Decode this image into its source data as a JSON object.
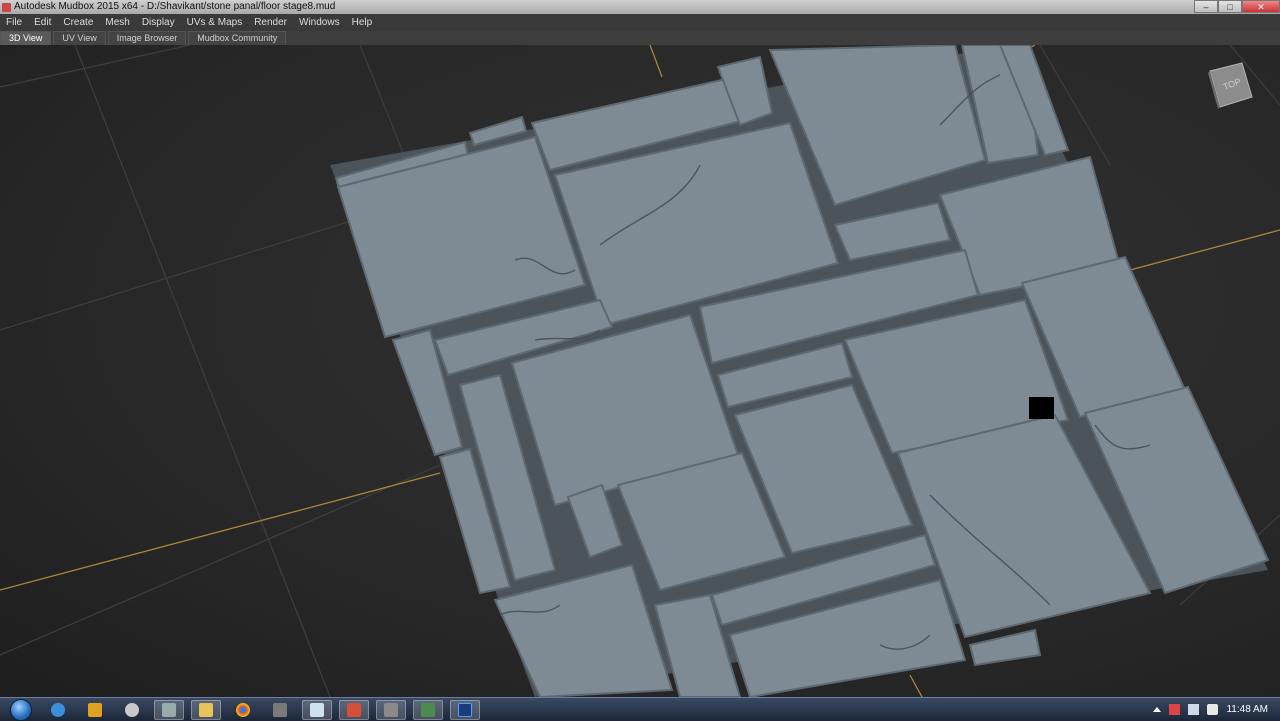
{
  "window": {
    "title": "Autodesk Mudbox 2015 x64 - D:/Shavikant/stone panal/floor stage8.mud",
    "controls": [
      "–",
      "□",
      "✕"
    ]
  },
  "menu": [
    "File",
    "Edit",
    "Create",
    "Mesh",
    "Display",
    "UVs & Maps",
    "Render",
    "Windows",
    "Help"
  ],
  "tabs": [
    "3D View",
    "UV View",
    "Image Browser",
    "Mudbox Community"
  ],
  "active_tab": "3D View",
  "viewcube": {
    "label": "TOP"
  },
  "taskbar": {
    "apps": [
      "ie-icon",
      "media-player-icon",
      "chrome-like-icon",
      "settings-icon",
      "folder-icon",
      "chrome-icon",
      "tools-icon",
      "notepad-icon",
      "mudbox-icon",
      "app-icon",
      "monitor-icon",
      "photoshop-icon"
    ],
    "clock": "11:48 AM"
  },
  "colors": {
    "stone": "#7f8b94",
    "grout": "#505a62",
    "grid": "#3e3e3e",
    "axis": "#b8953d"
  }
}
